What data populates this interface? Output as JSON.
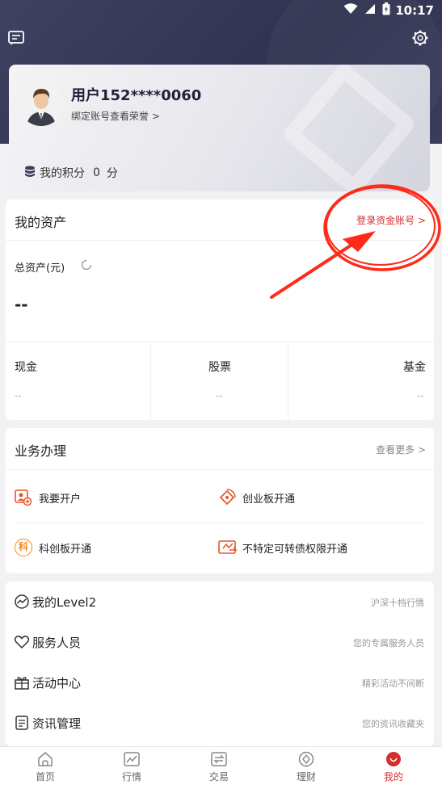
{
  "status_bar": {
    "time": "10:17"
  },
  "user": {
    "name": "用户152****0060",
    "bind_link": "绑定账号查看荣誉",
    "points_label": "我的积分",
    "points_value": "0",
    "points_unit": "分"
  },
  "assets": {
    "title": "我的资产",
    "login_link": "登录资金账号",
    "total_label": "总资产(元)",
    "total_value": "--",
    "columns": [
      {
        "label": "现金",
        "value": "--"
      },
      {
        "label": "股票",
        "value": "--"
      },
      {
        "label": "基金",
        "value": "--"
      }
    ]
  },
  "business": {
    "title": "业务办理",
    "more_link": "查看更多",
    "items": [
      {
        "label": "我要开户"
      },
      {
        "label": "创业板开通"
      },
      {
        "label": "科创板开通",
        "icon_text": "科"
      },
      {
        "label": "不特定可转债权限开通"
      }
    ]
  },
  "menu": [
    {
      "label": "我的Level2",
      "hint": "沪深十档行情",
      "icon": "chart-icon"
    },
    {
      "label": "服务人员",
      "hint": "您的专属服务人员",
      "icon": "heart-icon"
    },
    {
      "label": "活动中心",
      "hint": "精彩活动不间断",
      "icon": "gift-icon"
    },
    {
      "label": "资讯管理",
      "hint": "您的资讯收藏夹",
      "icon": "document-icon"
    }
  ],
  "tabs": [
    {
      "label": "首页",
      "icon": "home-icon"
    },
    {
      "label": "行情",
      "icon": "market-chart-icon"
    },
    {
      "label": "交易",
      "icon": "trade-icon"
    },
    {
      "label": "理财",
      "icon": "finance-icon"
    },
    {
      "label": "我的",
      "icon": "profile-icon"
    }
  ],
  "colors": {
    "accent": "#d32f2f",
    "header_bg": "#3a3d5c",
    "annotation": "#ff2a1a"
  }
}
